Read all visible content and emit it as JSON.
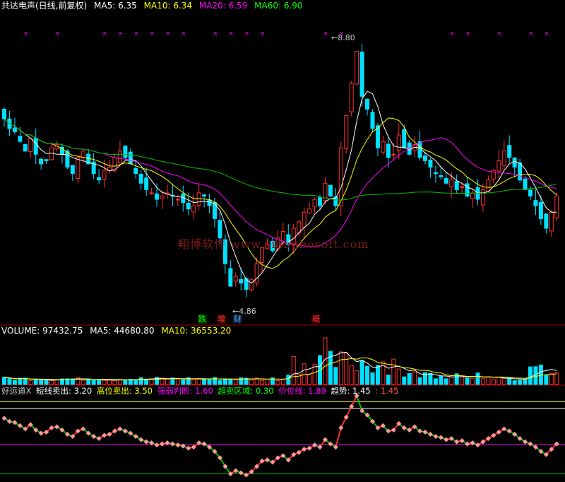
{
  "header": {
    "title": "共达电声(日线,前复权)",
    "ma": [
      {
        "label": "MA5: 6.35",
        "color": "#ffffff"
      },
      {
        "label": "MA10: 6.34",
        "color": "#ffff00"
      },
      {
        "label": "MA20: 6.59",
        "color": "#ff00ff"
      },
      {
        "label": "MA60: 6.90",
        "color": "#00ff00"
      }
    ]
  },
  "volume_header": {
    "items": [
      {
        "label": "VOLUME: 97432.75",
        "color": "#ffffff"
      },
      {
        "label": "MA5: 44680.80",
        "color": "#ffffff"
      },
      {
        "label": "MA10: 36553.20",
        "color": "#ffff00"
      }
    ]
  },
  "indicator_header": {
    "items": [
      {
        "label": "好运道X",
        "color": "#cccccc"
      },
      {
        "label": "短线卖出: 3.20",
        "color": "#ffffff"
      },
      {
        "label": "高位卖出: 3.50",
        "color": "#ffff00"
      },
      {
        "label": "强弱判断: 1.60",
        "color": "#ff00ff"
      },
      {
        "label": "超卖区域: 0.30",
        "color": "#00ff00"
      },
      {
        "label": "价位线: 1.89",
        "color": "#ff00ff"
      },
      {
        "label": "趋势: 1.45",
        "color": "#ffffff"
      },
      {
        "label": ": 1.45",
        "color": "#ff5555"
      }
    ]
  },
  "watermark": "翔博软件 www.xiangbosoft.com",
  "annotations": {
    "high": "8.80",
    "low": "4.86",
    "tags": [
      {
        "text": "跌",
        "color": "#00ff00",
        "bg": "#003300"
      },
      {
        "text": "增",
        "color": "#ff3333",
        "bg": "#330000"
      },
      {
        "text": "财",
        "color": "#66aaff",
        "bg": "#001a33"
      },
      {
        "text": "概",
        "color": "#ff3333",
        "bg": "#330000"
      }
    ]
  },
  "colors": {
    "up": "#ff3030",
    "down": "#00e0ff",
    "ma5": "#ffffff",
    "ma10": "#ffff00",
    "ma20": "#ff00ff",
    "ma60": "#00c000",
    "marker": "#ff00ff",
    "panel_border": "#a00000"
  },
  "chart_data": {
    "type": "candlestick",
    "price_range": [
      4.4,
      9.2
    ],
    "closes": [
      7.55,
      7.4,
      7.35,
      7.2,
      7.05,
      7.25,
      7.0,
      6.85,
      6.9,
      7.1,
      7.15,
      7.0,
      6.8,
      6.7,
      6.95,
      7.05,
      6.85,
      6.7,
      6.6,
      6.75,
      6.8,
      6.95,
      7.05,
      6.95,
      6.85,
      6.7,
      6.55,
      6.45,
      6.4,
      6.3,
      6.35,
      6.4,
      6.35,
      6.3,
      6.25,
      6.15,
      6.2,
      6.4,
      6.35,
      6.2,
      6.0,
      5.7,
      5.3,
      4.95,
      5.1,
      5.0,
      4.9,
      5.05,
      5.3,
      5.55,
      5.6,
      5.5,
      5.7,
      5.8,
      5.6,
      5.85,
      5.95,
      6.1,
      6.15,
      6.3,
      6.2,
      6.55,
      6.35,
      6.2,
      7.1,
      7.6,
      8.1,
      8.6,
      7.9,
      7.7,
      7.4,
      7.1,
      7.2,
      6.95,
      7.0,
      7.3,
      7.1,
      7.0,
      7.15,
      6.95,
      6.9,
      6.8,
      6.7,
      6.65,
      6.55,
      6.6,
      6.45,
      6.5,
      6.35,
      6.4,
      6.3,
      6.45,
      6.6,
      6.75,
      6.9,
      7.05,
      6.95,
      6.8,
      6.6,
      6.45,
      6.35,
      6.2,
      6.0,
      5.85,
      6.1,
      6.35
    ],
    "volume_header_values": {
      "volume": 97432.75,
      "ma5": 44680.8,
      "ma10": 36553.2
    },
    "indicator_levels": [
      3.2,
      3.5,
      1.6,
      0.3
    ],
    "indicator_header_values": {
      "price_line": 1.89,
      "trend": 1.45
    }
  }
}
